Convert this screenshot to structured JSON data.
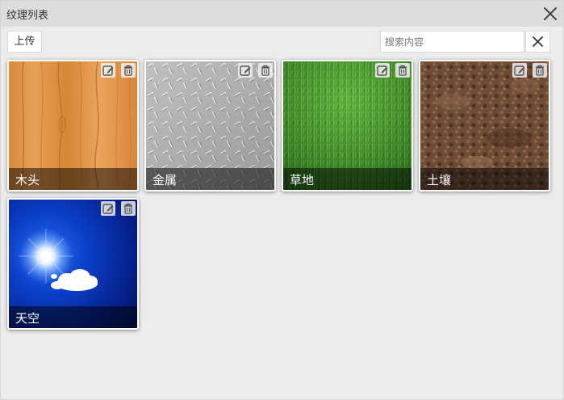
{
  "window": {
    "title": "纹理列表"
  },
  "toolbar": {
    "upload_label": "上传"
  },
  "search": {
    "placeholder": "搜索内容",
    "value": ""
  },
  "textures": [
    {
      "name": "木头",
      "texture": "wood"
    },
    {
      "name": "金属",
      "texture": "metal-tread-plate"
    },
    {
      "name": "草地",
      "texture": "grass"
    },
    {
      "name": "土壤",
      "texture": "soil"
    },
    {
      "name": "天空",
      "texture": "sky-with-sun-and-cloud"
    }
  ],
  "icons": {
    "close": "close-icon",
    "edit": "edit-icon",
    "delete": "trash-icon"
  },
  "colors": {
    "titlebar": "#dcdcdc",
    "background": "#ececec"
  }
}
